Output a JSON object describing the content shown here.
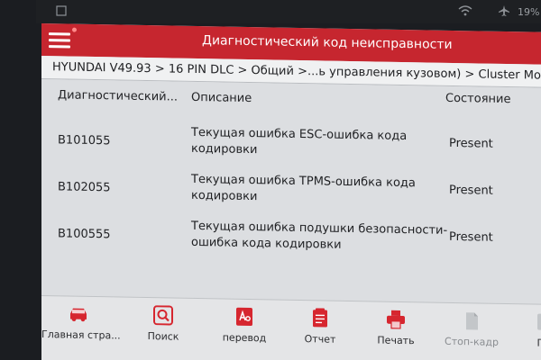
{
  "status_bar": {
    "battery_text": "19%"
  },
  "colors": {
    "accent": "#c6262f",
    "toolbar_icon": "#d6262f",
    "disabled": "#a8abaf"
  },
  "header": {
    "title": "Диагностический код неисправности"
  },
  "breadcrumb": {
    "path": "HYUNDAI V49.93 > 16 PIN DLC > Общий  >...ь управления кузовом) > Cluster Mod"
  },
  "table": {
    "columns": {
      "code": "Диагностический...",
      "description": "Описание",
      "state": "Состояние"
    },
    "rows": [
      {
        "code": "B101055",
        "description": "Текущая ошибка ESC-ошибка кода кодировки",
        "state": "Present"
      },
      {
        "code": "B102055",
        "description": "Текущая ошибка TPMS-ошибка кода кодировки",
        "state": "Present"
      },
      {
        "code": "B100555",
        "description": "Текущая ошибка подушки безопасности-ошибка кода кодировки",
        "state": "Present"
      }
    ]
  },
  "toolbar": {
    "items": [
      {
        "label": "Главная стра...",
        "icon": "car-home-icon"
      },
      {
        "label": "Поиск",
        "icon": "search-icon"
      },
      {
        "label": "перевод",
        "icon": "translate-icon"
      },
      {
        "label": "Отчет",
        "icon": "report-icon"
      },
      {
        "label": "Печать",
        "icon": "print-icon"
      },
      {
        "label": "Стоп-кадр",
        "icon": "freeze-frame-icon"
      },
      {
        "label": "По",
        "icon": "help-icon"
      }
    ]
  }
}
